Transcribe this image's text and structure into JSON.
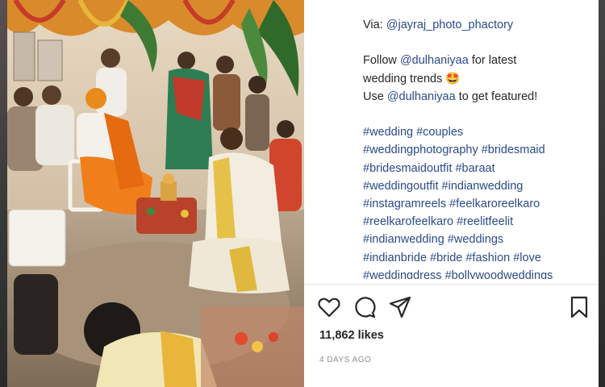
{
  "post": {
    "caption": {
      "via_prefix": "Via: ",
      "via_handle": "@jayraj_photo_phactory",
      "follow_prefix": "Follow ",
      "follow_handle": "@dulhaniyaa",
      "follow_suffix": " for latest",
      "follow_line2": "wedding trends 🤩",
      "use_prefix": "Use ",
      "use_handle": "@dulhaniyaa",
      "use_suffix": " to get featured!",
      "hashtag_lines": [
        "#wedding #couples",
        "#weddingphotography #bridesmaid",
        "#bridesmaidoutfit #baraat",
        "#weddingoutfit #indianwedding",
        "#instagramreels #feelkaroreelkaro",
        "#reelkarofeelkaro #reelitfeelit",
        "#indianwedding #weddings",
        "#indianbride #bride #fashion #love",
        "#weddingdress #bollywoodweddings"
      ]
    },
    "likes": "11,862 likes",
    "timestamp": "4 DAYS AGO"
  },
  "icons": {
    "like": "heart-icon",
    "comment": "comment-icon",
    "share": "send-icon",
    "save": "bookmark-icon"
  },
  "colors": {
    "hashtag": "#2b4a8a",
    "text": "#262626",
    "muted": "#8e8e8e"
  }
}
